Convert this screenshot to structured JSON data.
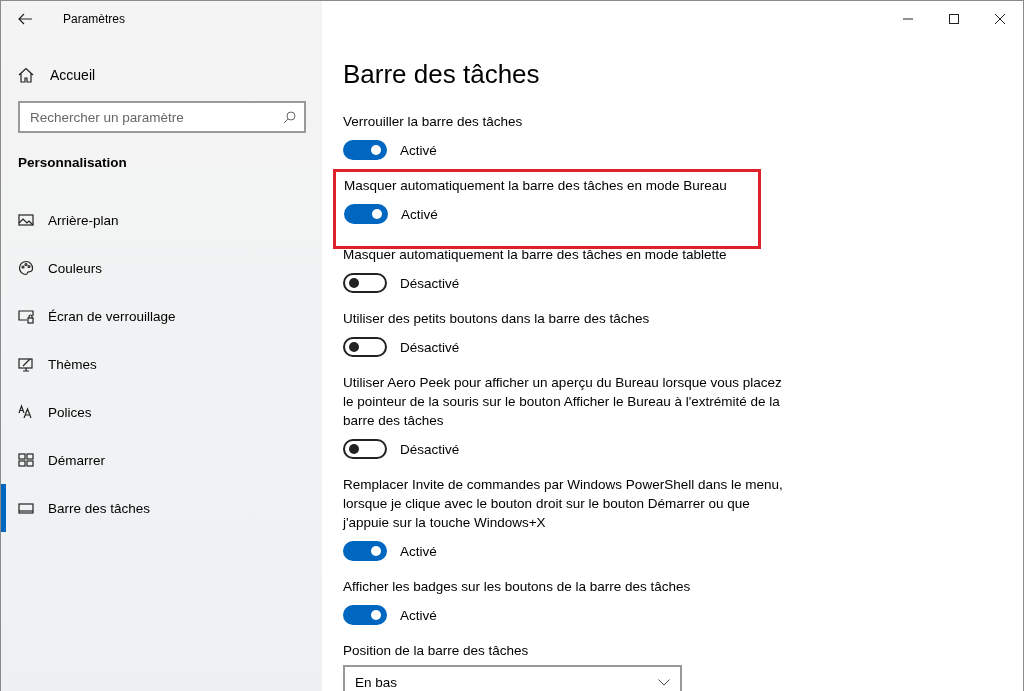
{
  "window": {
    "title": "Paramètres"
  },
  "sidebar": {
    "home": "Accueil",
    "search": {
      "placeholder": "Rechercher un paramètre"
    },
    "section": "Personnalisation",
    "items": [
      {
        "label": "Arrière-plan",
        "kind": "picture",
        "selected": false
      },
      {
        "label": "Couleurs",
        "kind": "palette",
        "selected": false
      },
      {
        "label": "Écran de verrouillage",
        "kind": "lock",
        "selected": false
      },
      {
        "label": "Thèmes",
        "kind": "themes",
        "selected": false
      },
      {
        "label": "Polices",
        "kind": "fonts",
        "selected": false
      },
      {
        "label": "Démarrer",
        "kind": "start",
        "selected": false
      },
      {
        "label": "Barre des tâches",
        "kind": "taskbar",
        "selected": true
      }
    ]
  },
  "page": {
    "title": "Barre des tâches",
    "settings": [
      {
        "kind": "toggle",
        "label": "Verrouiller la barre des tâches",
        "on": true,
        "state": "Activé",
        "highlighted": false
      },
      {
        "kind": "toggle",
        "label": "Masquer automatiquement la barre des tâches en mode Bureau",
        "on": true,
        "state": "Activé",
        "highlighted": true
      },
      {
        "kind": "toggle",
        "label": "Masquer automatiquement la barre des tâches en mode tablette",
        "on": false,
        "state": "Désactivé",
        "highlighted": false
      },
      {
        "kind": "toggle",
        "label": "Utiliser des petits boutons dans la barre des tâches",
        "on": false,
        "state": "Désactivé",
        "highlighted": false
      },
      {
        "kind": "toggle",
        "label": "Utiliser Aero Peek pour afficher un aperçu du Bureau lorsque vous placez le pointeur de la souris sur le bouton Afficher le Bureau à l'extrémité de la barre des tâches",
        "on": false,
        "state": "Désactivé",
        "highlighted": false
      },
      {
        "kind": "toggle",
        "label": "Remplacer Invite de commandes par Windows PowerShell dans le menu, lorsque je clique avec le bouton droit sur le bouton Démarrer ou que j'appuie sur la touche Windows+X",
        "on": true,
        "state": "Activé",
        "highlighted": false
      },
      {
        "kind": "toggle",
        "label": "Afficher les badges sur les boutons de la barre des tâches",
        "on": true,
        "state": "Activé",
        "highlighted": false
      },
      {
        "kind": "dropdown",
        "label": "Position de la barre des tâches",
        "value": "En bas",
        "highlighted": false
      }
    ]
  }
}
